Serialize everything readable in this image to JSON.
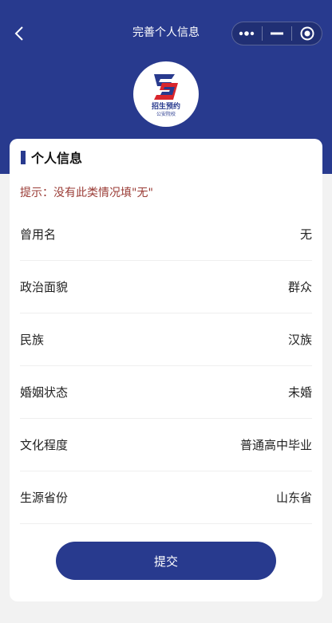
{
  "nav": {
    "title": "完善个人信息",
    "back_icon": "chevron-left-icon",
    "capsule": {
      "more_icon": "more-dots-icon",
      "minimize_icon": "minimize-icon",
      "close_icon": "target-close-icon"
    }
  },
  "logo": {
    "name": "招生预约",
    "subtitle": "公安院校",
    "colors": {
      "blue": "#283a8e",
      "red": "#d9262d"
    }
  },
  "card": {
    "title": "个人信息",
    "hint": "提示：没有此类情况填\"无\"",
    "rows": [
      {
        "label": "曾用名",
        "value": "无"
      },
      {
        "label": "政治面貌",
        "value": "群众"
      },
      {
        "label": "民族",
        "value": "汉族"
      },
      {
        "label": "婚姻状态",
        "value": "未婚"
      },
      {
        "label": "文化程度",
        "value": "普通高中毕业"
      },
      {
        "label": "生源省份",
        "value": "山东省"
      }
    ],
    "submit_label": "提交"
  },
  "colors": {
    "primary": "#283a8e",
    "hint": "#9a3b35",
    "background": "#f2f2f2"
  }
}
